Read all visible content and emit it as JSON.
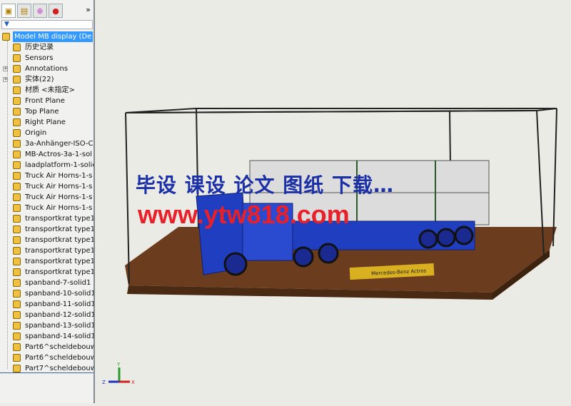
{
  "panel": {
    "more": "»",
    "filter_icon": "filter-icon",
    "tabs": [
      "feature-manager",
      "property-manager",
      "configuration-manager",
      "display-manager"
    ]
  },
  "tree": [
    {
      "label": "Model MB display  (De",
      "icon": "part-icon",
      "root": true
    },
    {
      "label": "历史记录",
      "icon": "history-icon"
    },
    {
      "label": "Sensors",
      "icon": "sensor-icon"
    },
    {
      "label": "Annotations",
      "icon": "annotation-icon",
      "expand": true
    },
    {
      "label": "实体(22)",
      "icon": "solid-bodies-icon",
      "expand": true
    },
    {
      "label": "材质 <未指定>",
      "icon": "material-icon"
    },
    {
      "label": "Front Plane",
      "icon": "plane-icon"
    },
    {
      "label": "Top Plane",
      "icon": "plane-icon"
    },
    {
      "label": "Right Plane",
      "icon": "plane-icon"
    },
    {
      "label": "Origin",
      "icon": "origin-icon"
    },
    {
      "label": "3a-Anhänger-ISO-C",
      "icon": "body-icon"
    },
    {
      "label": "MB-Actros-3a-1-sol",
      "icon": "body-icon"
    },
    {
      "label": "laadplatform-1-solic",
      "icon": "body-icon"
    },
    {
      "label": "Truck Air Horns-1-s",
      "icon": "body-icon"
    },
    {
      "label": "Truck Air Horns-1-s",
      "icon": "body-icon"
    },
    {
      "label": "Truck Air Horns-1-s",
      "icon": "body-icon"
    },
    {
      "label": "Truck Air Horns-1-s",
      "icon": "body-icon"
    },
    {
      "label": "transportkrat type1",
      "icon": "body-icon"
    },
    {
      "label": "transportkrat type1",
      "icon": "body-icon"
    },
    {
      "label": "transportkrat type1",
      "icon": "body-icon"
    },
    {
      "label": "transportkrat type1",
      "icon": "body-icon"
    },
    {
      "label": "transportkrat type1",
      "icon": "body-icon"
    },
    {
      "label": "transportkrat type1",
      "icon": "body-icon"
    },
    {
      "label": "spanband-7-solid1",
      "icon": "body-icon"
    },
    {
      "label": "spanband-10-solid1",
      "icon": "body-icon"
    },
    {
      "label": "spanband-11-solid1",
      "icon": "body-icon"
    },
    {
      "label": "spanband-12-solid1",
      "icon": "body-icon"
    },
    {
      "label": "spanband-13-solid1",
      "icon": "body-icon"
    },
    {
      "label": "spanband-14-solid1",
      "icon": "body-icon"
    },
    {
      "label": "Part6^scheldebouw",
      "icon": "body-icon"
    },
    {
      "label": "Part6^scheldebouw",
      "icon": "body-icon"
    },
    {
      "label": "Part7^scheldebouw",
      "icon": "body-icon"
    }
  ],
  "viewport": {
    "plaque": "Mercedes-Benz Actros",
    "trailer_text": "Mercedes-Benz",
    "watermark_line1": "毕设 课设 论文 图纸 下载…",
    "watermark_line2": "www.ytw818.com",
    "triad": {
      "x": "X",
      "y": "Y",
      "z": "Z"
    }
  },
  "colors": {
    "selection": "#3399ff",
    "truck": "#1f3fc0",
    "base": "#6b3d1e"
  }
}
